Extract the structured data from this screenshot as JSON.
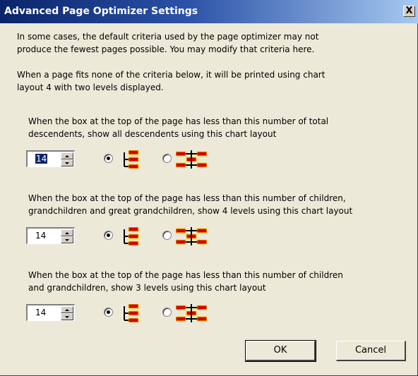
{
  "window": {
    "title": "Advanced Page Optimizer Settings",
    "close_glyph": "X"
  },
  "intro": {
    "line1": "In some cases, the default criteria used by the page optimizer may not",
    "line2": "produce the fewest pages possible. You may modify that criteria here."
  },
  "fallback": {
    "line1": "When a page fits none of the criteria below, it will be printed using chart",
    "line2": "layout 4 with two levels displayed."
  },
  "criteria": [
    {
      "line1": "When the box at the top of the page has less than this number of total",
      "line2": "descendents, show all descendents using this chart layout",
      "value": "14",
      "selected_layout": "descendant-tree"
    },
    {
      "line1": "When the box at the top of the page has less than this number of children,",
      "line2": "grandchildren and great grandchildren, show 4 levels using this chart layout",
      "value": "14",
      "selected_layout": "descendant-tree"
    },
    {
      "line1": "When the box at the top of the page has less than this number of children",
      "line2": "and grandchildren, show 3 levels using this chart layout",
      "value": "14",
      "selected_layout": "descendant-tree"
    }
  ],
  "icons": {
    "layout_a": "vertical-tree-chart-icon",
    "layout_b": "hourglass-tree-chart-icon"
  },
  "colors": {
    "title_start": "#0a246a",
    "title_end": "#a6caf0",
    "box_red": "#d40000",
    "box_yellow": "#ffd800"
  },
  "buttons": {
    "ok": "OK",
    "cancel": "Cancel"
  }
}
